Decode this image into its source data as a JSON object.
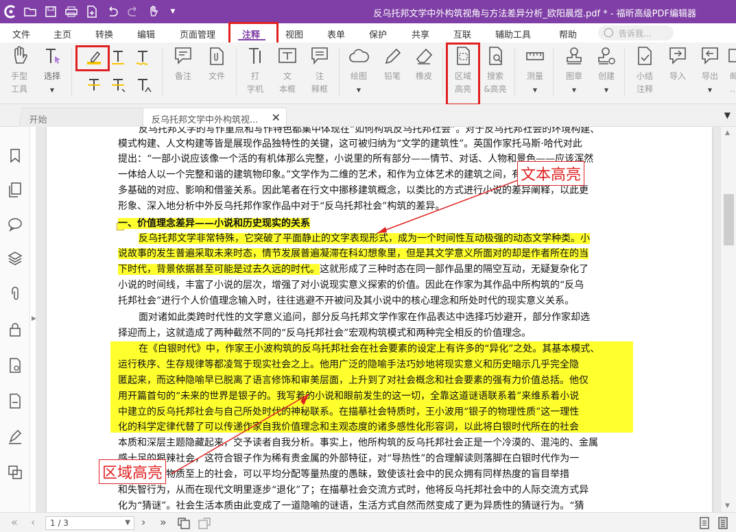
{
  "window": {
    "title": "反乌托邦文学中外构筑视角与方法差异分析_欧阳晨煜.pdf * - 福昕高级PDF编辑器",
    "app_icon": "foxit-logo-icon",
    "quick_access": [
      "open-folder-icon",
      "save-icon",
      "print-icon",
      "new-doc-icon",
      "undo-icon",
      "redo-icon",
      "hand-tool-icon",
      "dropdown-icon"
    ]
  },
  "menu": {
    "items": [
      "文件",
      "主页",
      "转换",
      "编辑",
      "页面管理",
      "注释",
      "视图",
      "表单",
      "保护",
      "共享",
      "互联",
      "辅助工具",
      "帮助"
    ],
    "active": "注释",
    "search_placeholder": "告诉我..."
  },
  "ribbon": {
    "hand": "手型\n工具",
    "select": "选择",
    "note": "备注",
    "file": "文件",
    "typewriter": "打\n字机",
    "textbox": "文\n本框",
    "callout": "注\n释框",
    "drawing": "绘图",
    "pencil": "铅笔",
    "eraser": "橡皮",
    "area_highlight": "区域\n高亮",
    "search_highlight": "搜索\n&高亮",
    "measure": "测量",
    "stamp": "图章",
    "create": "创建",
    "summary": "小结\n注释",
    "import": "导入",
    "export": "导出",
    "overflow": "邮\n…"
  },
  "tabs": {
    "start": "开始",
    "doc": "反乌托邦文学中外构筑视..."
  },
  "document": {
    "lines": [
      "反乌托邦文学的写作重点和写作特色都集中体现在“如何构筑反乌托邦社会”。对于反乌托邦社会的环境构建、",
      "模式构建、人文构建等皆是展现作品独特性的关键，这可被归纳为“文学的建筑性”。英国作家托马斯·哈代对此",
      "提出：“一部小说应该像一个活的有机体那么完整，小说里的所有部分——情节、对话、人物和景色——应该浑然",
      "一体给人以一个完整和谐的建筑物印象。”文学作为二维的艺术，和作为立体艺术的建筑之间，有着许",
      "多基础的对应、影响和借鉴关系。因此笔者在行文中挪移建筑概念，以类比的方式进行小说的差异阐释，以此更",
      "形象、深入地分析中外反乌托邦作家作品中对于“反乌托邦社会”构筑的差异。"
    ],
    "heading": "一、价值理念差异——小说和历史现实的关系",
    "para2_lines_hl": [
      "反乌托邦文学非常特殊，它突破了平面静止的文字表现形式，成为一个时间性互动极强的动态文学种类。小",
      "说故事的发生普遍采取未来时态，情节发展普遍凝滞在科幻想象里，但是其文学意义所面对的却是作者所在的当",
      "下时代，背景依据甚至可能是过去久远的时代。"
    ],
    "para2_rest_first": "这就形成了三种时态在同一部作品里的隔空互动，无疑复杂化了",
    "para2_lines": [
      "小说的时间线，丰富了小说的层次，增强了对小说现实意义探索的价值。因此在作家为其作品中所构筑的“反乌",
      "托邦社会”进行个人价值理念输入时，往往逃避不开被问及其小说中的核心理念和所处时代的现实意义关系。",
      "面对诸如此类跨时代性的文学意义追问，部分反乌托邦文学作家在作品表达中选择巧妙避开，部分作家却选",
      "择迎而上，这就造成了两种截然不同的“反乌托邦社会”宏观构筑模式和两种完全相反的价值理念。"
    ],
    "para3_lines": [
      "在《白银时代》中，作家王小波构筑的反乌托邦社会在社会要素的设定上有许多的“异化”之处。其基本模式、",
      "运行秩序、生存规律等都凌驾于现实社会之上。他用广泛的隐喻手法巧妙地将现实意义和历史暗示几乎完全隐",
      "匿起来，而这种隐喻早已脱离了语言修饰和审美层面，上升到了对社会概念和社会要素的强有力价值总括。他仅",
      "用开篇首句的“未来的世界是银子的。我写着的小说和眼前发生的这一切，全靠这道谜语联系着”来维系着小说",
      "中建立的反乌托邦社会与自己所处时代的神秘联系。在描摹社会特质时，王小波用“银子的物理性质”这一理性",
      "化的科学定律代替了可以传递作家自我价值理念和主观态度的诸多感性化形容词，以此将白银时代所在的社会"
    ],
    "para4_lines": [
      "本质和深层主题隐藏起来，交予读者自我分析。事实上，他所构筑的反乌托邦社会正是一个冷漠的、混沌的、金属",
      "感十足的狠辣社会，这符合银子作为稀有贵金属的外部特征，对“导热性”的合理解读则落脚在白银时代作为一",
      "个冷漠的、物质至上的社会，可以平均分配等量热度的愚昧，致使该社会中的民众拥有同样热度的盲目举措",
      "和失智行为，从而在现代文明里逐步“退化”了；在描摹社会交流方式时，他将反乌托邦社会中的人际交流方式异",
      "化为“猜谜”。社会生活本质由此变成了一道隐喻的谜语，生活方式自然而然变成了更为异质性的猜谜行为。“猜"
    ],
    "callout_text": "文本高亮",
    "callout_area": "区域高亮"
  },
  "status": {
    "page": "1 / 3"
  },
  "colors": {
    "brand": "#7f3fa6",
    "highlight": "#ffff2e",
    "annotation_red": "#e02020"
  }
}
